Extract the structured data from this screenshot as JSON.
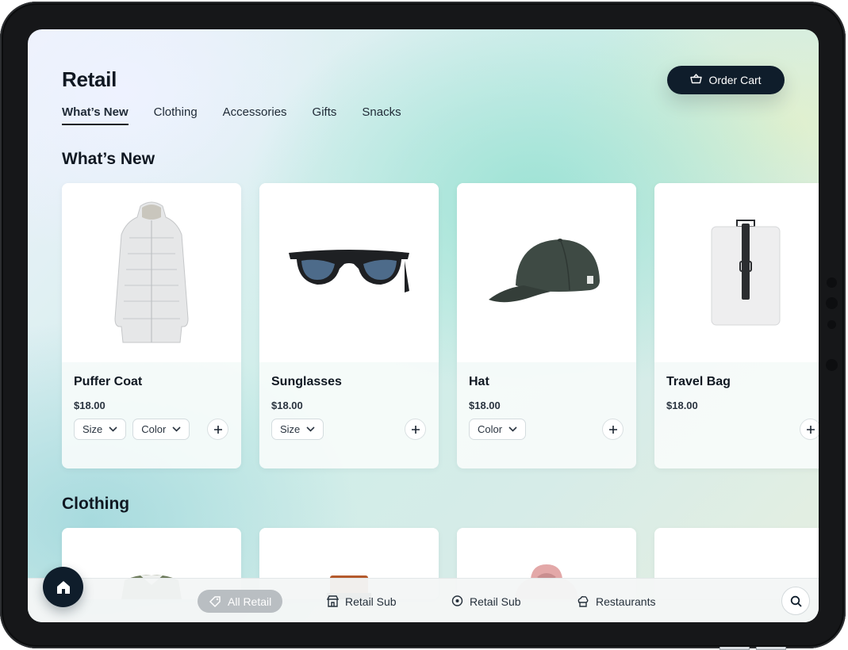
{
  "page": {
    "title": "Retail"
  },
  "tabs": [
    {
      "label": "What’s New",
      "active": true
    },
    {
      "label": "Clothing",
      "active": false
    },
    {
      "label": "Accessories",
      "active": false
    },
    {
      "label": "Gifts",
      "active": false
    },
    {
      "label": "Snacks",
      "active": false
    }
  ],
  "order_cart": {
    "label": "Order Cart",
    "icon": "basket-icon"
  },
  "sections": {
    "whats_new": {
      "title": "What’s New",
      "products": [
        {
          "name": "Puffer Coat",
          "price": "$18.00",
          "image": "puffer-coat-image",
          "options": [
            "Size",
            "Color"
          ]
        },
        {
          "name": "Sunglasses",
          "price": "$18.00",
          "image": "sunglasses-image",
          "options": [
            "Size"
          ]
        },
        {
          "name": "Hat",
          "price": "$18.00",
          "image": "hat-image",
          "options": [
            "Color"
          ]
        },
        {
          "name": "Travel Bag",
          "price": "$18.00",
          "image": "travel-bag-image",
          "options": []
        }
      ]
    },
    "clothing": {
      "title": "Clothing",
      "products": [
        {
          "image": "green-jacket-image"
        },
        {
          "image": "brown-wallet-image"
        },
        {
          "image": "pink-hoodie-image"
        },
        {
          "image": "empty-image"
        }
      ]
    }
  },
  "bottom_nav": {
    "items": [
      {
        "label": "All Retail",
        "icon": "tag-icon",
        "active": true
      },
      {
        "label": "Retail Sub",
        "icon": "store-icon",
        "active": false
      },
      {
        "label": "Retail Sub",
        "icon": "location-pin-icon",
        "active": false
      },
      {
        "label": "Restaurants",
        "icon": "chef-icon",
        "active": false
      }
    ],
    "search_icon": "search-icon",
    "home_icon": "home-icon"
  },
  "colors": {
    "primary": "#0f1d2b",
    "active_pill": "#b9bec2"
  }
}
